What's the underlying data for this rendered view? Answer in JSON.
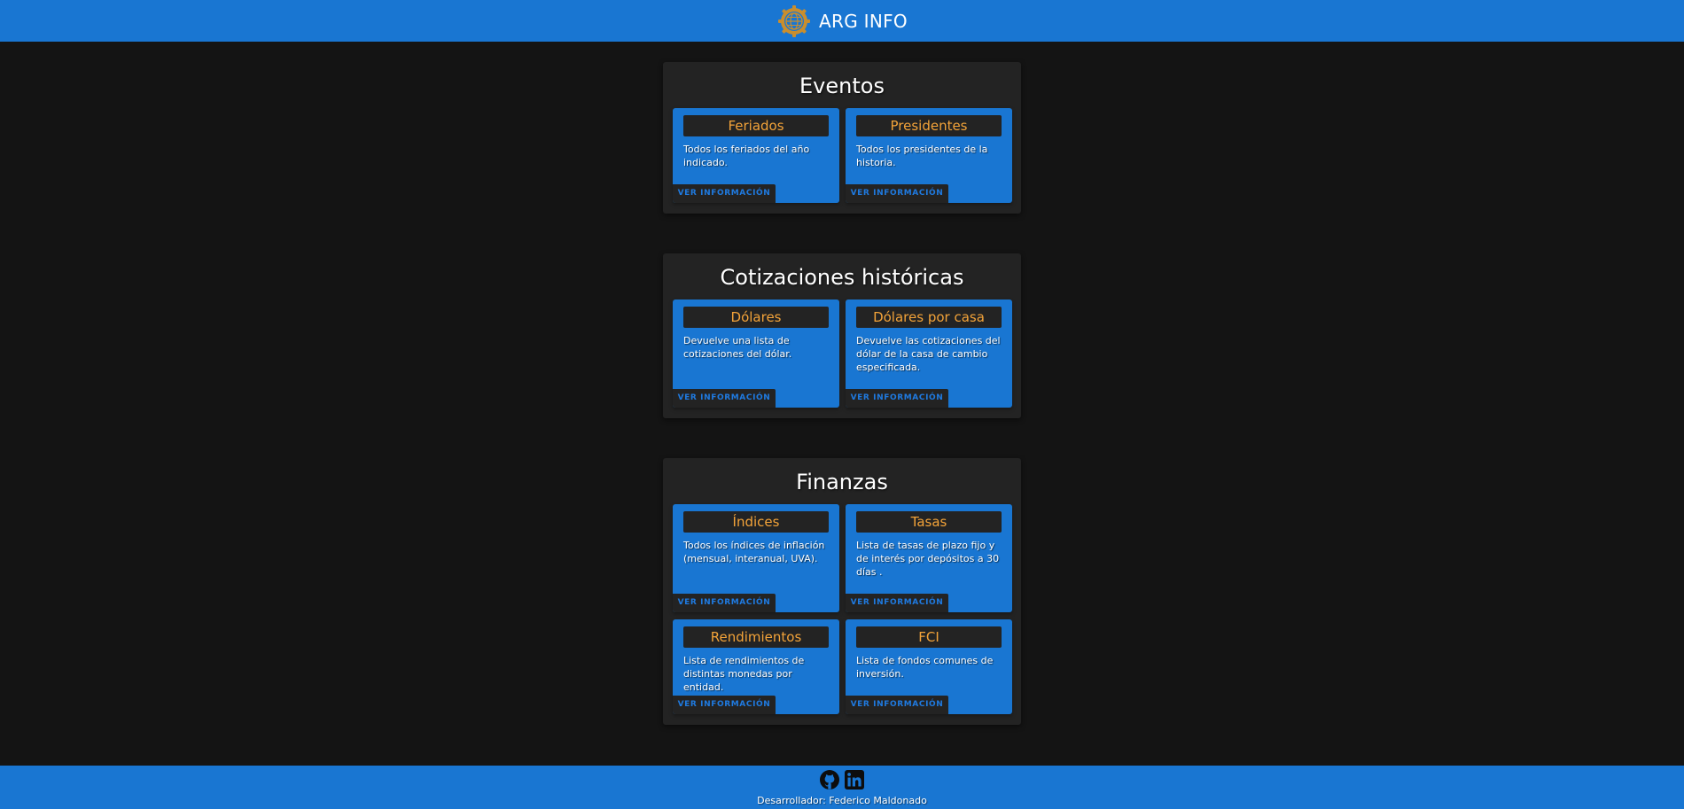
{
  "header": {
    "brand": "ARG INFO",
    "logo_icon": "gear-globe-icon"
  },
  "colors": {
    "header_bg": "#1976d2",
    "page_bg": "#141414",
    "section_bg": "#232323",
    "card_bg": "#1976d2",
    "card_title_text": "#f3a339",
    "button_text": "#1f7ae0"
  },
  "sections": [
    {
      "title": "Eventos",
      "cards": [
        {
          "title": "Feriados",
          "description": "Todos los feriados del año indicado.",
          "button": "VER INFORMACIÓN"
        },
        {
          "title": "Presidentes",
          "description": "Todos los presidentes de la historia.",
          "button": "VER INFORMACIÓN"
        }
      ]
    },
    {
      "title": "Cotizaciones históricas",
      "cards": [
        {
          "title": "Dólares",
          "description": "Devuelve una lista de cotizaciones del dólar.",
          "button": "VER INFORMACIÓN"
        },
        {
          "title": "Dólares por casa",
          "description": "Devuelve las cotizaciones del dólar de la casa de cambio especificada.",
          "button": "VER INFORMACIÓN"
        }
      ]
    },
    {
      "title": "Finanzas",
      "cards": [
        {
          "title": "Índices",
          "description": "Todos los índices de inflación (mensual, interanual, UVA).",
          "button": "VER INFORMACIÓN"
        },
        {
          "title": "Tasas",
          "description": "Lista de tasas de plazo fijo y de interés por depósitos a 30 días .",
          "button": "VER INFORMACIÓN"
        },
        {
          "title": "Rendimientos",
          "description": "Lista de rendimientos de distintas monedas por entidad.",
          "button": "VER INFORMACIÓN"
        },
        {
          "title": "FCI",
          "description": "Lista de fondos comunes de inversión.",
          "button": "VER INFORMACIÓN"
        }
      ]
    }
  ],
  "footer": {
    "icons": [
      "github-icon",
      "linkedin-icon"
    ],
    "credit": "Desarrollador: Federico Maldonado"
  }
}
